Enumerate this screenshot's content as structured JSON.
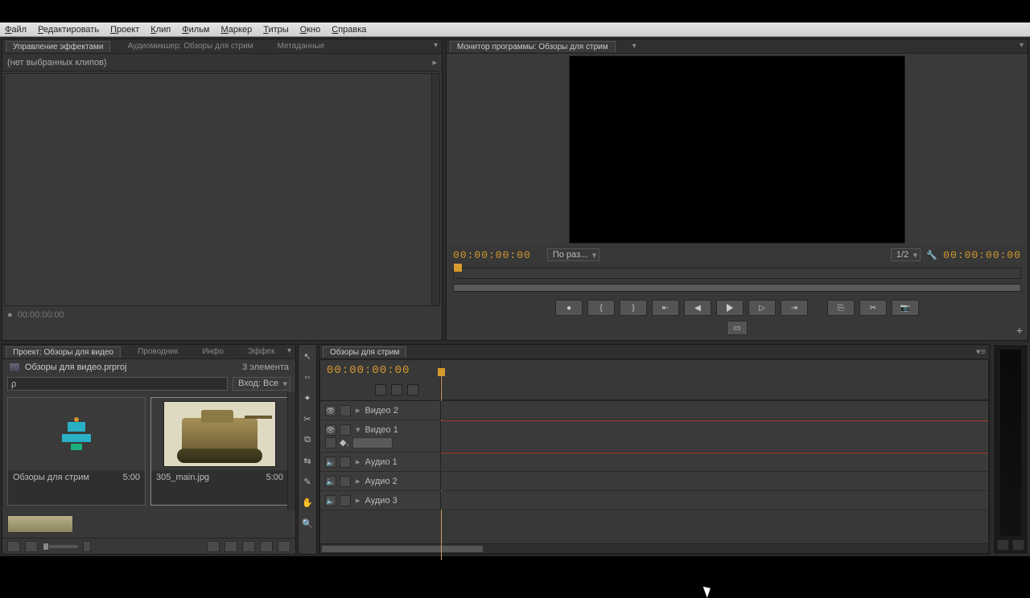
{
  "menu": {
    "items": [
      "Файл",
      "Редактировать",
      "Проект",
      "Клип",
      "Фильм",
      "Маркер",
      "Титры",
      "Окно",
      "Справка"
    ]
  },
  "effect_controls": {
    "tabs": {
      "active": "Управление эффектами",
      "others": [
        "Аудиомикшер: Обзоры для стрим",
        "Метаданные"
      ]
    },
    "header": "(нет выбранных клипов)",
    "footer_time": "00:00:00:00"
  },
  "program": {
    "tab": "Монитор программы: Обзоры для стрим",
    "timecode_left": "00:00:00:00",
    "fit_label": "По раз...",
    "scale_label": "1/2",
    "timecode_right": "00:00:00:00",
    "transport_icons": [
      "●",
      "{",
      "}",
      "⇤",
      "◀",
      "▶",
      "▷",
      "⇥",
      "⎘",
      "✂",
      "📷"
    ]
  },
  "project": {
    "tabs": {
      "active": "Проект: Обзоры для видео",
      "others": [
        "Проводник",
        "Инфо",
        "Эффек"
      ]
    },
    "file_name": "Обзоры для видео.prproj",
    "item_count": "3 элемента",
    "search_placeholder": "ρ",
    "sort_label": "Вход:  Все",
    "bins": [
      {
        "name": "Обзоры для стрим",
        "duration": "5:00",
        "kind": "sequence"
      },
      {
        "name": "305_main.jpg",
        "duration": "5:00",
        "kind": "image"
      }
    ]
  },
  "timeline": {
    "tab": "Обзоры для стрим",
    "timecode": "00:00:00:00",
    "tracks_video": [
      "Видео 2",
      "Видео 1"
    ],
    "tracks_audio": [
      "Аудио 1",
      "Аудио 2",
      "Аудио 3"
    ]
  },
  "tools": [
    "↖",
    "⇔",
    "✦",
    "✂",
    "⧉",
    "⇆",
    "✎",
    "✋",
    "🔍"
  ]
}
